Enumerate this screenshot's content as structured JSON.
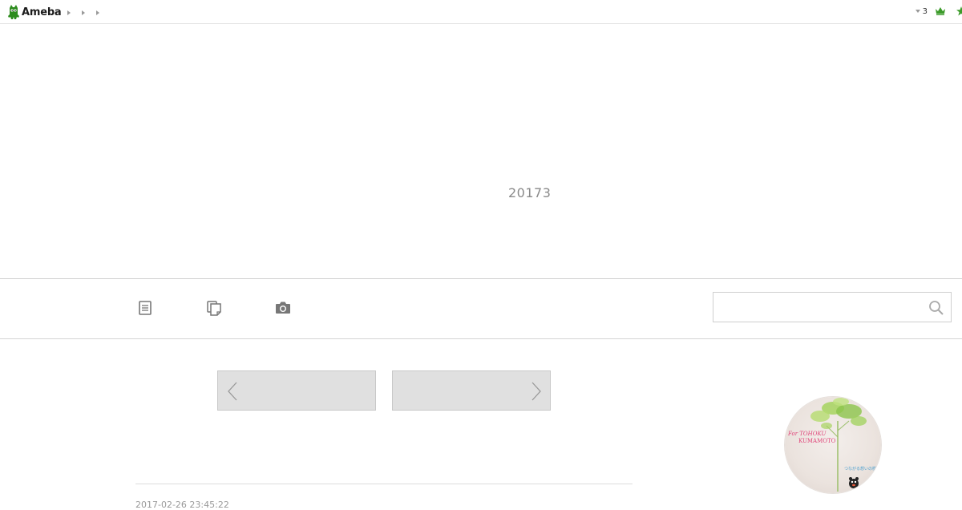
{
  "header": {
    "logo_text": "Ameba",
    "breadcrumb_count": 3,
    "notification_count": "3",
    "colors": {
      "brand": "#2d8c1e",
      "border": "#e3e3e3"
    },
    "icons": [
      "ameba-logo-icon",
      "crown-icon",
      "star-icon",
      "caret-down-icon"
    ]
  },
  "blog": {
    "title": "20173"
  },
  "nav": {
    "icons": [
      "article-list-icon",
      "theme-list-icon",
      "image-list-icon",
      "search-icon"
    ],
    "search": {
      "value": "",
      "placeholder": ""
    }
  },
  "pager": {
    "prev_label": "",
    "next_label": ""
  },
  "article": {
    "date": "2017-02-26 23:45:22"
  },
  "profile": {
    "image_text_line1": "For TOHOKU",
    "image_text_line2": "KUMAMOTO",
    "image_text_line3": "つながる想いの樹"
  }
}
